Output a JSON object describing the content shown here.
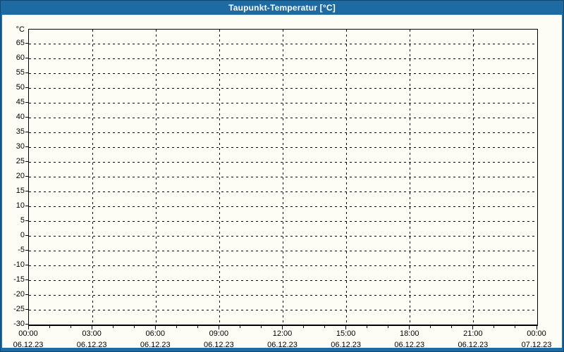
{
  "header": {
    "title": "Taupunkt-Temperatur [°C]"
  },
  "chart_data": {
    "type": "line",
    "title": "Taupunkt-Temperatur [°C]",
    "xlabel": "",
    "ylabel": "°C",
    "ylim": [
      -30,
      70
    ],
    "y_tick_step": 5,
    "y_ticks": [
      65,
      60,
      55,
      50,
      45,
      40,
      35,
      30,
      25,
      20,
      15,
      10,
      5,
      0,
      -5,
      -10,
      -15,
      -20,
      -25,
      -30
    ],
    "x_span_hours": 24,
    "x_major_ticks": [
      {
        "hour": 0,
        "time": "00:00",
        "date": "06.12.23"
      },
      {
        "hour": 3,
        "time": "03:00",
        "date": "06.12.23"
      },
      {
        "hour": 6,
        "time": "06:00",
        "date": "06.12.23"
      },
      {
        "hour": 9,
        "time": "09:00",
        "date": "06.12.23"
      },
      {
        "hour": 12,
        "time": "12:00",
        "date": "06.12.23"
      },
      {
        "hour": 15,
        "time": "15:00",
        "date": "06.12.23"
      },
      {
        "hour": 18,
        "time": "18:00",
        "date": "06.12.23"
      },
      {
        "hour": 21,
        "time": "21:00",
        "date": "06.12.23"
      },
      {
        "hour": 24,
        "time": "00:00",
        "date": "07.12.23"
      }
    ],
    "x_minor_tick_every_hours": 1,
    "grid": "dashed",
    "legend_position": "none",
    "series": []
  },
  "colors": {
    "titlebar_bg": "#1e6ba3",
    "frame_border": "#11486f",
    "canvas_bg": "#fdfdf6",
    "axis": "#000000",
    "grid": "#000000",
    "title_text": "#ffffff",
    "label_text": "#000000"
  }
}
